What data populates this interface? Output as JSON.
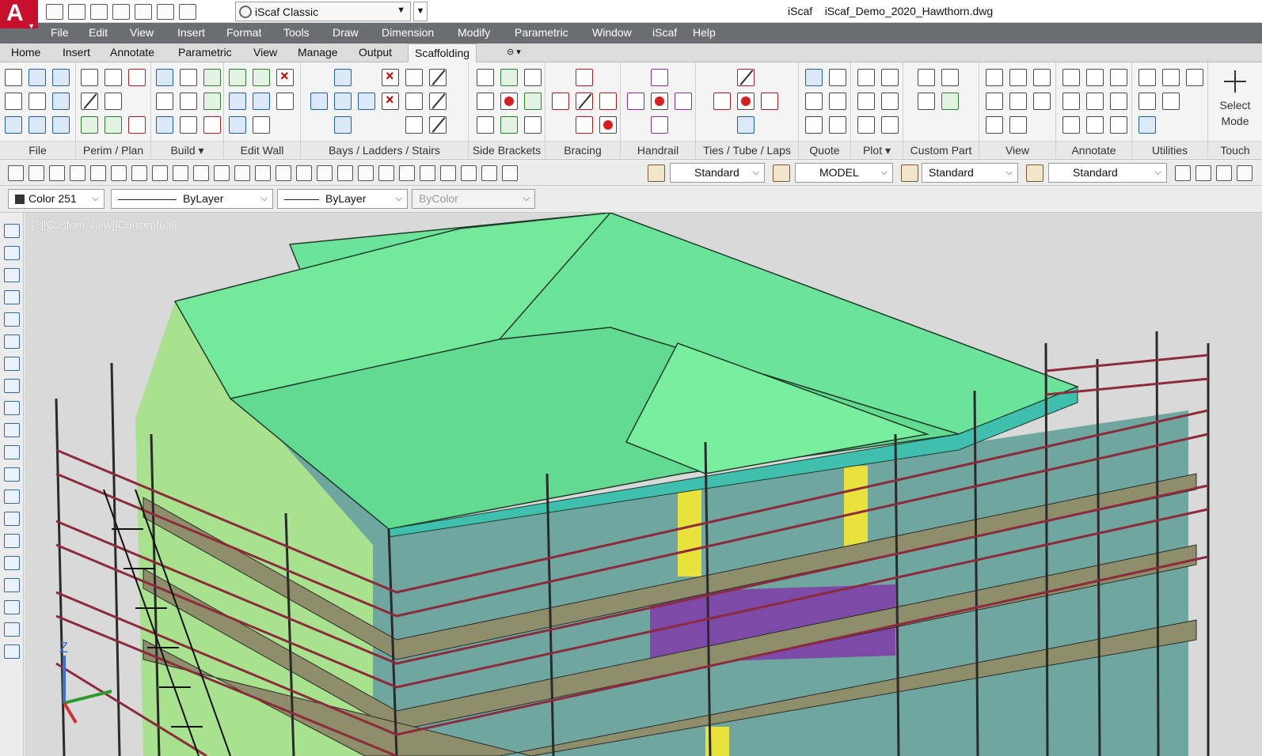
{
  "titlebar": {
    "workspace": "iScaf Classic",
    "app_name": "iScaf",
    "file_name": "iScaf_Demo_2020_Hawthorn.dwg",
    "logo_letter": "A"
  },
  "menu": [
    "File",
    "Edit",
    "View",
    "Insert",
    "Format",
    "Tools",
    "Draw",
    "Dimension",
    "Modify",
    "Parametric",
    "Window",
    "iScaf",
    "Help"
  ],
  "ribbon_tabs": [
    "Home",
    "Insert",
    "Annotate",
    "Parametric",
    "View",
    "Manage",
    "Output",
    "Scaffolding"
  ],
  "active_tab": "Scaffolding",
  "panels": [
    "File",
    "Perim / Plan",
    "Build",
    "Edit Wall",
    "Bays /  Ladders / Stairs",
    "Side Brackets",
    "Bracing",
    "Handrail",
    "Ties / Tube / Laps",
    "Quote",
    "Plot",
    "Custom Part",
    "View",
    "Annotate",
    "Utilities",
    "Touch"
  ],
  "select_mode": {
    "line1": "Select",
    "line2": "Mode"
  },
  "toolbar1": {
    "text_style": "Standard",
    "space": "MODEL",
    "dim_style": "Standard",
    "table_style": "Standard"
  },
  "properties": {
    "color": "Color 251",
    "linetype": "ByLayer",
    "lineweight": "ByLayer",
    "plotstyle": "ByColor"
  },
  "viewport": {
    "label": "[−][Custom View][Conceptual]",
    "ucs_z": "Z"
  },
  "colors": {
    "roof": "#6be39a",
    "wall": "#6fa7a0",
    "scaffold_pipe": "#2a2a2a",
    "scaffold_rail": "#8c2b3c",
    "deck": "#8f8e6b",
    "accent": "#e9e23c",
    "brand": "#c8102e"
  }
}
